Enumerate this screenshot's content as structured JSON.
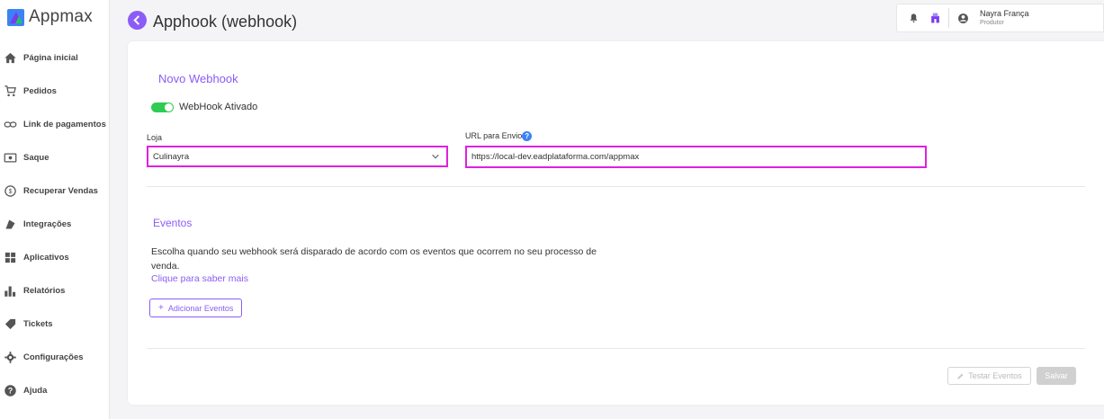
{
  "brand": {
    "name": "Appmax",
    "accent": "#8b5cf6",
    "highlight": "#e020e0",
    "toggle_on": "#2ecc52"
  },
  "sidebar": {
    "items": [
      {
        "label": "Página inicial",
        "icon": "home-icon"
      },
      {
        "label": "Pedidos",
        "icon": "cart-icon"
      },
      {
        "label": "Link de pagamentos",
        "icon": "link-icon"
      },
      {
        "label": "Saque",
        "icon": "cash-icon"
      },
      {
        "label": "Recuperar Vendas",
        "icon": "recover-icon"
      },
      {
        "label": "Integrações",
        "icon": "puzzle-icon"
      },
      {
        "label": "Aplicativos",
        "icon": "apps-grid-icon"
      },
      {
        "label": "Relatórios",
        "icon": "bar-chart-icon"
      },
      {
        "label": "Tickets",
        "icon": "ticket-icon"
      },
      {
        "label": "Configurações",
        "icon": "gear-icon"
      },
      {
        "label": "Ajuda",
        "icon": "help-icon"
      }
    ]
  },
  "header": {
    "title": "Apphook (webhook)"
  },
  "user": {
    "name": "Nayra França",
    "role": "Produtor"
  },
  "form": {
    "title": "Novo Webhook",
    "toggle_label": "WebHook Ativado",
    "toggle_on": true,
    "store_label": "Loja",
    "store_value": "Culinayra",
    "url_label": "URL para Envio",
    "url_value": "https://local-dev.eadplataforma.com/appmax"
  },
  "events": {
    "title": "Eventos",
    "description": "Escolha quando seu webhook será disparado de acordo com os eventos que ocorrem no seu processo de venda.",
    "learn_more": "Clique para saber mais",
    "add_button": "Adicionar Eventos"
  },
  "actions": {
    "test_label": "Testar Eventos",
    "save_label": "Salvar"
  }
}
